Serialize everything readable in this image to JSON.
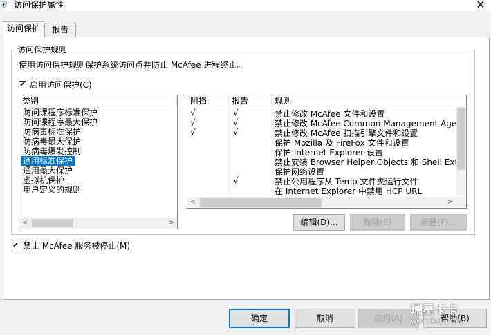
{
  "window": {
    "title": "访问保护属性",
    "close_glyph": "✕"
  },
  "tabs": [
    {
      "label": "访问保护"
    },
    {
      "label": "报告"
    }
  ],
  "group": {
    "title": "访问保护规则",
    "description": "使用访问保护规则保护系统访问点并防止 McAfee 进程终止。",
    "enable_label": "启用访问保护(C)",
    "enable_checked": true
  },
  "categories": {
    "header": "类别",
    "items": [
      "防问课程序标准保护",
      "防问课程序最大保护",
      "防病毒标准保护",
      "防病毒最大保护",
      "防病毒爆发控制",
      "通用标准保护",
      "通用最大保护",
      "虚拟机保护",
      "用户定义的规则"
    ],
    "selected_index": 5
  },
  "rules": {
    "headers": {
      "block": "阻挡",
      "report": "报告",
      "rule": "规则"
    },
    "rows": [
      {
        "block": "√",
        "report": "√",
        "rule": "禁止修改 McAfee 文件和设置"
      },
      {
        "block": "√",
        "report": "√",
        "rule": "禁止修改 McAfee Common Management Agent 文件和"
      },
      {
        "block": "√",
        "report": "√",
        "rule": "禁止修改 McAfee 扫描引擎文件和设置"
      },
      {
        "block": "",
        "report": "",
        "rule": "保护 Mozilla 及 FireFox 文件和设置"
      },
      {
        "block": "",
        "report": "",
        "rule": "保护 Internet Explorer 设置"
      },
      {
        "block": "",
        "report": "",
        "rule": "禁止安装 Browser Helper Objects 和 Shell Extensions"
      },
      {
        "block": "",
        "report": "",
        "rule": "保护网络设置"
      },
      {
        "block": "",
        "report": "√",
        "rule": "禁止公用程序从 Temp 文件夹运行文件"
      },
      {
        "block": "",
        "report": "",
        "rule": "在 Internet Explorer 中禁用 HCP URL"
      }
    ]
  },
  "rule_buttons": {
    "edit": "编辑(D)...",
    "delete": "删除(E)",
    "new": "新建(F)..."
  },
  "stop_service": {
    "label": "禁止 McAfee 服务被停止(M)",
    "checked": true
  },
  "footer": {
    "ok": "确定",
    "cancel": "取消",
    "apply": "应用(A)",
    "help": "帮助(B)"
  },
  "watermark": {
    "text": "瑞星卡卡",
    "url": "www.ikaka.com"
  },
  "icons": {
    "check": "✔",
    "left": "<",
    "right": ">",
    "app": "shield-icon"
  }
}
